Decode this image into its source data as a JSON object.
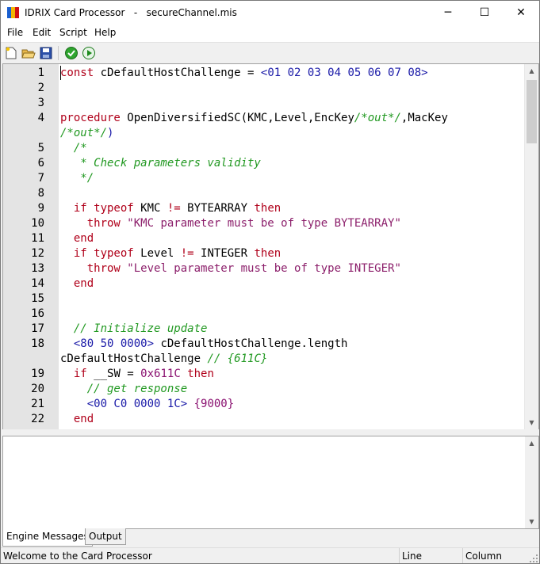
{
  "window": {
    "app_name": "IDRIX Card Processor",
    "separator": "-",
    "file_name": "secureChannel.mis",
    "min_glyph": "─",
    "max_glyph": "☐",
    "close_glyph": "✕"
  },
  "menu": [
    "File",
    "Edit",
    "Script",
    "Help"
  ],
  "toolbar": {
    "buttons": [
      "new-file-icon",
      "open-folder-icon",
      "save-icon",
      "check-icon",
      "run-icon"
    ]
  },
  "editor": {
    "scroll_up_glyph": "▲",
    "scroll_down_glyph": "▼",
    "lines": [
      {
        "num": "1",
        "tokens": [
          [
            "kw",
            "const"
          ],
          [
            "",
            "cDefaultHostChallenge = "
          ],
          [
            "hex",
            "<01 02 03 04 05 06 07 08>"
          ]
        ]
      },
      {
        "num": "2",
        "tokens": []
      },
      {
        "num": "3",
        "tokens": []
      },
      {
        "num": "4",
        "tokens": [
          [
            "kw",
            "procedure"
          ],
          [
            "",
            "OpenDiversifiedSC(KMC,Level,EncKey"
          ],
          [
            "cmt",
            "/*out*/"
          ],
          [
            "",
            ",MacKey"
          ]
        ]
      },
      {
        "num": "",
        "tokens": [
          [
            "cmt",
            "/*out*/"
          ],
          [
            "hex",
            ")"
          ]
        ]
      },
      {
        "num": "5",
        "tokens": [
          [
            "cmt",
            "  /*"
          ]
        ]
      },
      {
        "num": "6",
        "tokens": [
          [
            "cmt",
            "   * Check parameters validity"
          ]
        ]
      },
      {
        "num": "7",
        "tokens": [
          [
            "cmt",
            "   */"
          ]
        ]
      },
      {
        "num": "8",
        "tokens": []
      },
      {
        "num": "9",
        "tokens": [
          [
            "kw",
            "  if typeof"
          ],
          [
            "",
            "KMC "
          ],
          [
            "kw",
            "!="
          ],
          [
            "",
            "BYTEARRAY "
          ],
          [
            "kw",
            "then"
          ]
        ]
      },
      {
        "num": "10",
        "tokens": [
          [
            "kw",
            "    throw"
          ],
          [
            "str",
            "\"KMC parameter must be of type BYTEARRAY\""
          ]
        ]
      },
      {
        "num": "11",
        "tokens": [
          [
            "kw",
            "  end"
          ]
        ]
      },
      {
        "num": "12",
        "tokens": [
          [
            "kw",
            "  if typeof"
          ],
          [
            "",
            "Level "
          ],
          [
            "kw",
            "!="
          ],
          [
            "",
            "INTEGER "
          ],
          [
            "kw",
            "then"
          ]
        ]
      },
      {
        "num": "13",
        "tokens": [
          [
            "kw",
            "    throw"
          ],
          [
            "str",
            "\"Level parameter must be of type INTEGER\""
          ]
        ]
      },
      {
        "num": "14",
        "tokens": [
          [
            "kw",
            "  end"
          ]
        ]
      },
      {
        "num": "15",
        "tokens": []
      },
      {
        "num": "16",
        "tokens": []
      },
      {
        "num": "17",
        "tokens": [
          [
            "cmt",
            "  // Initialize update"
          ]
        ]
      },
      {
        "num": "18",
        "tokens": [
          [
            "hex",
            "  <80 50 0000>"
          ],
          [
            "",
            "cDefaultHostChallenge.length"
          ]
        ]
      },
      {
        "num": "",
        "tokens": [
          [
            "",
            "cDefaultHostChallenge "
          ],
          [
            "cmt",
            "// {611C}"
          ]
        ]
      },
      {
        "num": "19",
        "tokens": [
          [
            "kw",
            "  if"
          ],
          [
            "",
            "__SW = "
          ],
          [
            "num",
            "0x611C"
          ],
          [
            "kw",
            "then"
          ]
        ]
      },
      {
        "num": "20",
        "tokens": [
          [
            "cmt",
            "    // get response"
          ]
        ]
      },
      {
        "num": "21",
        "tokens": [
          [
            "hex",
            "    <00 C0 0000 1C>"
          ],
          [
            "num",
            "{9000}"
          ]
        ]
      },
      {
        "num": "22",
        "tokens": [
          [
            "kw",
            "  end"
          ]
        ]
      }
    ]
  },
  "tabs": [
    "Engine Messages",
    "Output"
  ],
  "status": {
    "message": "Welcome to the Card Processor",
    "line_label": "Line",
    "column_label": "Column"
  }
}
